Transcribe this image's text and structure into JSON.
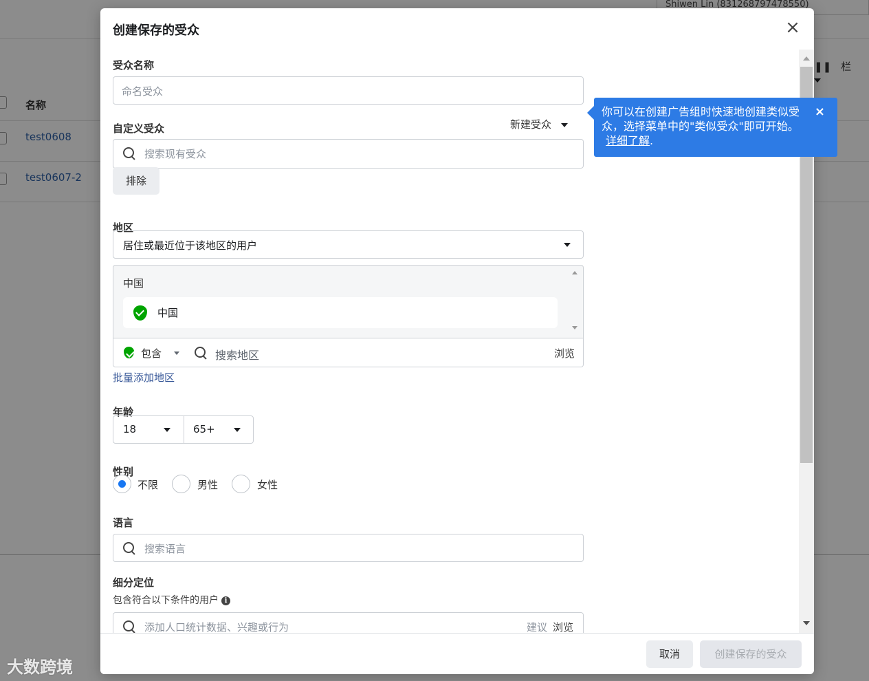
{
  "background": {
    "user": "Shiwen Lin (831268797478550)",
    "column_header": "名称",
    "rows": [
      "test0608",
      "test0607-2"
    ],
    "tools_label": "栏"
  },
  "modal": {
    "title": "创建保存的受众",
    "audience_name": {
      "label": "受众名称",
      "placeholder": "命名受众"
    },
    "custom_audience": {
      "label": "自定义受众",
      "new_audience": "新建受众",
      "search_placeholder": "搜索现有受众",
      "exclude_label": "排除"
    },
    "location": {
      "label": "地区",
      "mode": "居住或最近位于该地区的用户",
      "country_header": "中国",
      "selected": "中国",
      "include_label": "包含",
      "search_placeholder": "搜索地区",
      "browse": "浏览",
      "bulk_add": "批量添加地区"
    },
    "age": {
      "label": "年龄",
      "min": "18",
      "max": "65+"
    },
    "gender": {
      "label": "性别",
      "options": [
        "不限",
        "男性",
        "女性"
      ],
      "selected": "不限"
    },
    "language": {
      "label": "语言",
      "search_placeholder": "搜索语言"
    },
    "detailed_targeting": {
      "label": "细分定位",
      "sublabel": "包含符合以下条件的用户",
      "search_placeholder": "添加人口统计数据、兴趣或行为",
      "suggestions": "建议",
      "browse": "浏览"
    },
    "footer": {
      "cancel": "取消",
      "create": "创建保存的受众"
    }
  },
  "tooltip": {
    "text": "你可以在创建广告组时快速地创建类似受众，选择菜单中的\"类似受众\"即可开始。",
    "learn_more": "详细了解",
    "period": "."
  },
  "watermark": "大数跨境",
  "colors": {
    "primary": "#1877f2",
    "tooltip": "#2d7be5",
    "include": "#00a400",
    "link": "#385898"
  }
}
